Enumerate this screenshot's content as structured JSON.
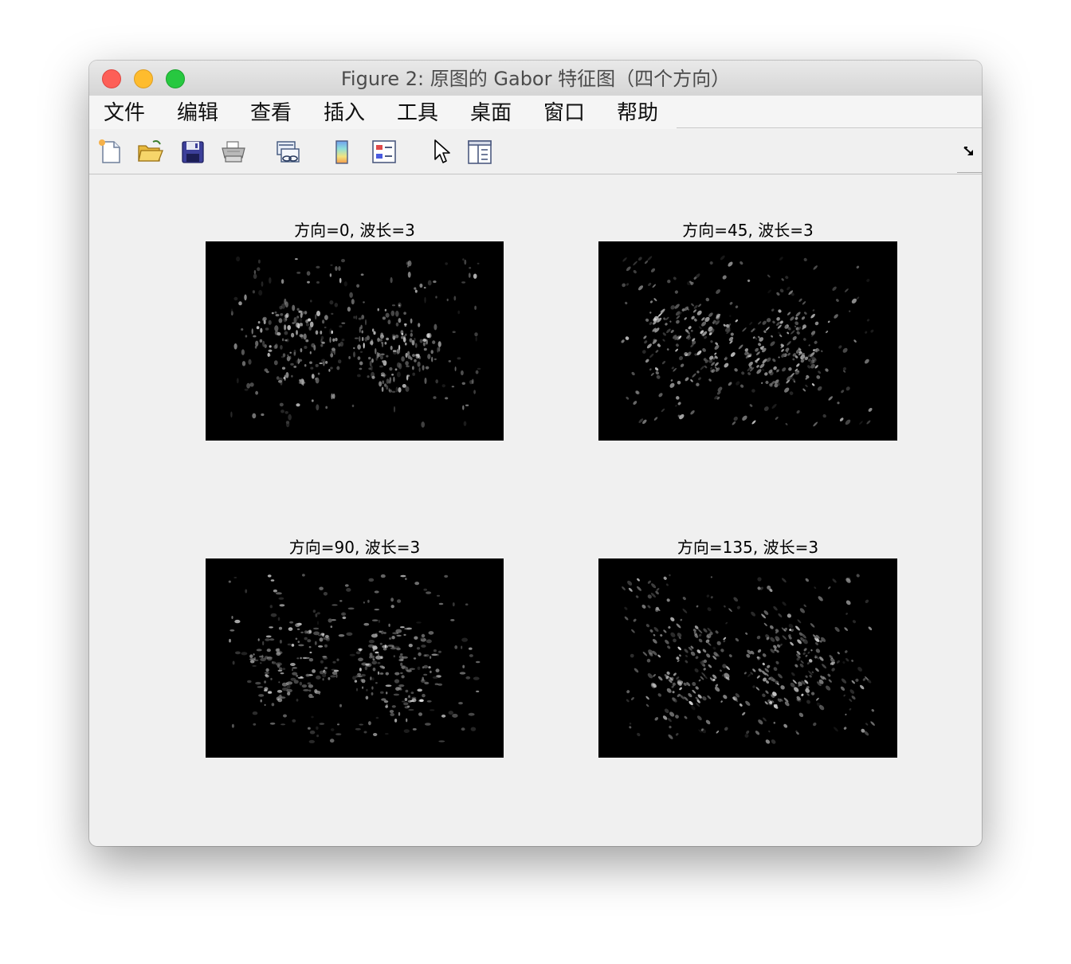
{
  "window": {
    "title": "Figure 2: 原图的 Gabor 特征图（四个方向）"
  },
  "menubar": {
    "items": [
      "文件",
      "编辑",
      "查看",
      "插入",
      "工具",
      "桌面",
      "窗口",
      "帮助"
    ]
  },
  "toolbar": {
    "icons": [
      "new-file-icon",
      "open-folder-icon",
      "save-disk-icon",
      "print-icon",
      "link-plot-icon",
      "colorbar-icon",
      "legend-icon",
      "pointer-arrow-icon",
      "property-inspector-icon"
    ],
    "corner_icon": "dock-arrow-icon"
  },
  "subplots": [
    {
      "title": "方向=0, 波长=3",
      "orientation": 0,
      "wavelength": 3
    },
    {
      "title": "方向=45, 波长=3",
      "orientation": 45,
      "wavelength": 3
    },
    {
      "title": "方向=90, 波长=3",
      "orientation": 90,
      "wavelength": 3
    },
    {
      "title": "方向=135, 波长=3",
      "orientation": 135,
      "wavelength": 3
    }
  ],
  "colors": {
    "titlebar": "#dcdcdc",
    "figure_background": "#f0f0f0",
    "image_background": "#000000",
    "close": "#fd5f57",
    "minimize": "#febc2e",
    "zoom": "#27c840"
  }
}
